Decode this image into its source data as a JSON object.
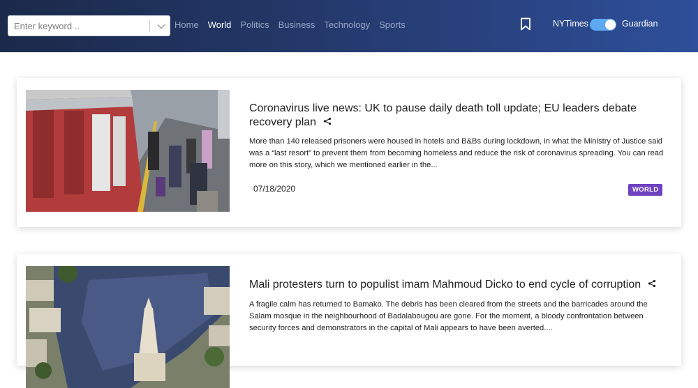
{
  "search": {
    "placeholder": "Enter keyword .."
  },
  "nav": {
    "links": [
      {
        "label": "Home",
        "active": false
      },
      {
        "label": "World",
        "active": true
      },
      {
        "label": "Politics",
        "active": false
      },
      {
        "label": "Business",
        "active": false
      },
      {
        "label": "Technology",
        "active": false
      },
      {
        "label": "Sports",
        "active": false
      }
    ]
  },
  "source_toggle": {
    "left_label": "NYTimes",
    "right_label": "Guardian",
    "selected": "Guardian",
    "on_color": "#5ea7f1"
  },
  "icons": {
    "bookmark": "bookmark-icon",
    "chevron": "chevron-down-icon",
    "share": "share-icon"
  },
  "articles": [
    {
      "title": "Coronavirus live news: UK to pause daily death toll update; EU leaders debate recovery plan",
      "description": "More than 140 released prisoners were housed in hotels and B&Bs during lockdown, in what the Ministry of Justice said was a “last resort” to prevent them from becoming homeless and reduce the risk of coronavirus spreading. You can read more on this story, which we mentioned earlier in the...",
      "date": "07/18/2020",
      "section": "WORLD",
      "image": "train-platform-photo"
    },
    {
      "title": "Mali protesters turn to populist imam Mahmoud Dicko to end cycle of corruption",
      "description": "A fragile calm has returned to Bamako. The debris has been cleared from the streets and the barricades around the Salam mosque in the neighbourhood of Badalabougou are gone. For the moment, a bloody confrontation between security forces and demonstrators in the capital of Mali appears to have been averted....",
      "image": "aerial-crowd-photo"
    }
  ],
  "colors": {
    "badge_world": "#6f42c1",
    "header_start": "#1b2a4a",
    "header_end": "#2e4f9a"
  }
}
